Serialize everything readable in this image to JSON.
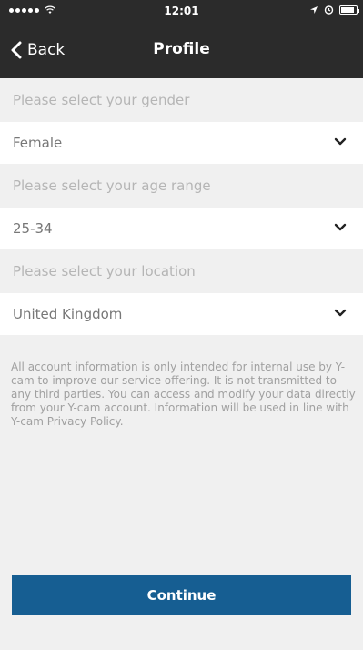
{
  "status_bar": {
    "time": "12:01",
    "icons": [
      "signal-dots-icon",
      "wifi-icon",
      "location-arrow-icon",
      "alarm-icon",
      "battery-icon"
    ]
  },
  "nav": {
    "back_label": "Back",
    "title": "Profile"
  },
  "form": {
    "gender": {
      "prompt": "Please select your gender",
      "value": "Female"
    },
    "age": {
      "prompt": "Please select your age range",
      "value": "25-34"
    },
    "location": {
      "prompt": "Please select your location",
      "value": "United Kingdom"
    }
  },
  "info": {
    "text": "All account information is only intended for internal use by Y-cam to improve our service offering. It is not transmitted to any third parties. You can access and modify your data directly from your Y-cam account. Information will be used in line with Y-cam Privacy Policy."
  },
  "continue_label": "Continue",
  "colors": {
    "bar_bg": "#2b2b2b",
    "page_bg": "#f0f0f0",
    "accent": "#165e92",
    "prompt_text": "#b5b5b5",
    "value_text": "#777777"
  }
}
